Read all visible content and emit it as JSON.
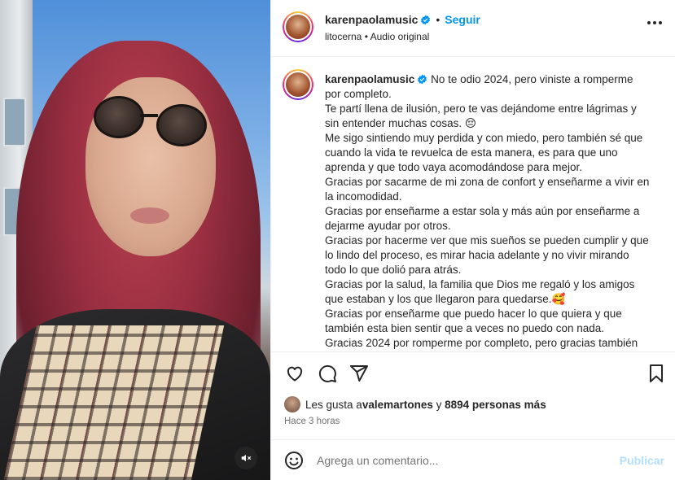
{
  "post": {
    "author": "karenpaolamusic",
    "follow_label": "Seguir",
    "separator": "•",
    "subtitle_user": "litocerna",
    "subtitle_audio": "Audio original",
    "caption_lines": [
      "No te odio 2024, pero viniste a romperme por completo.",
      "Te partí llena de ilusión, pero te vas dejándome entre lágrimas y sin entender muchas cosas. 😔",
      "Me sigo sintiendo muy perdida y con miedo, pero también sé que cuando la vida te revuelca de esta manera, es para que uno aprenda y que todo vaya acomodándose para mejor.",
      "Gracias por sacarme de mi zona de confort y enseñarme a vivir en la incomodidad.",
      "Gracias por enseñarme a estar sola y más aún por enseñarme a dejarme ayudar por otros.",
      "Gracias por hacerme ver que mis sueños se pueden cumplir y que lo lindo del proceso, es mirar hacia adelante y no vivir mirando todo lo que dolió para atrás.",
      "Gracias por la salud, la familia que Dios me regaló y los amigos que estaban y los que llegaron para quedarse.🥰",
      "Gracias por enseñarme que puedo hacer lo que quiera y que también esta bien sentir que a veces no puedo con nada.",
      "Gracias 2024 por romperme por completo, pero gracias también"
    ]
  },
  "likes": {
    "prefix": "Les gusta a ",
    "user": "valemartones",
    "middle": " y ",
    "count": "8894 personas más"
  },
  "time_ago": "Hace 3 horas",
  "comment": {
    "placeholder": "Agrega un comentario...",
    "publish_label": "Publicar"
  },
  "colors": {
    "accent": "#0095f6",
    "publish_disabled": "#b2dffc",
    "text": "#262626",
    "muted": "#737373"
  },
  "icons": [
    "heart-icon",
    "comment-icon",
    "share-icon",
    "bookmark-icon",
    "emoji-icon",
    "more-icon",
    "mute-icon",
    "verified-icon"
  ]
}
